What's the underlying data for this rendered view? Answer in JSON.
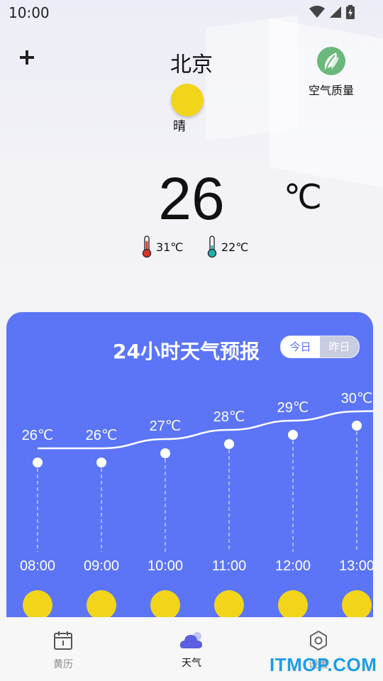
{
  "status_bar": {
    "time": "10:00"
  },
  "header": {
    "city": "北京",
    "condition": "晴",
    "air_quality_label": "空气质量"
  },
  "current": {
    "temp": "26",
    "unit": "℃",
    "high": "31℃",
    "low": "22℃"
  },
  "forecast": {
    "title": "24小时天气预报",
    "toggle_today": "今日",
    "toggle_yesterday": "昨日"
  },
  "chart_data": {
    "type": "line",
    "title": "24小时天气预报",
    "x": [
      "08:00",
      "09:00",
      "10:00",
      "11:00",
      "12:00",
      "13:00"
    ],
    "series": [
      {
        "values": [
          26,
          26,
          27,
          28,
          29,
          30
        ]
      }
    ],
    "labels": [
      "26℃",
      "26℃",
      "27℃",
      "28℃",
      "29℃",
      "30℃"
    ],
    "weather_icons": [
      "sunny",
      "sunny",
      "sunny",
      "sunny",
      "sunny",
      "sunny"
    ],
    "grid": false,
    "legend": "none"
  },
  "nav": {
    "items": [
      {
        "label": "黄历",
        "icon": "calendar-icon"
      },
      {
        "label": "天气",
        "icon": "cloud-icon"
      },
      {
        "label": "设置",
        "icon": "hexagon-icon"
      }
    ],
    "active": "天气"
  },
  "watermark": "ITMOP.COM",
  "colors": {
    "card": "#5b75f6",
    "sun": "#f2d51b",
    "leaf": "#6ab87b",
    "active_nav": "#5b75f6"
  }
}
